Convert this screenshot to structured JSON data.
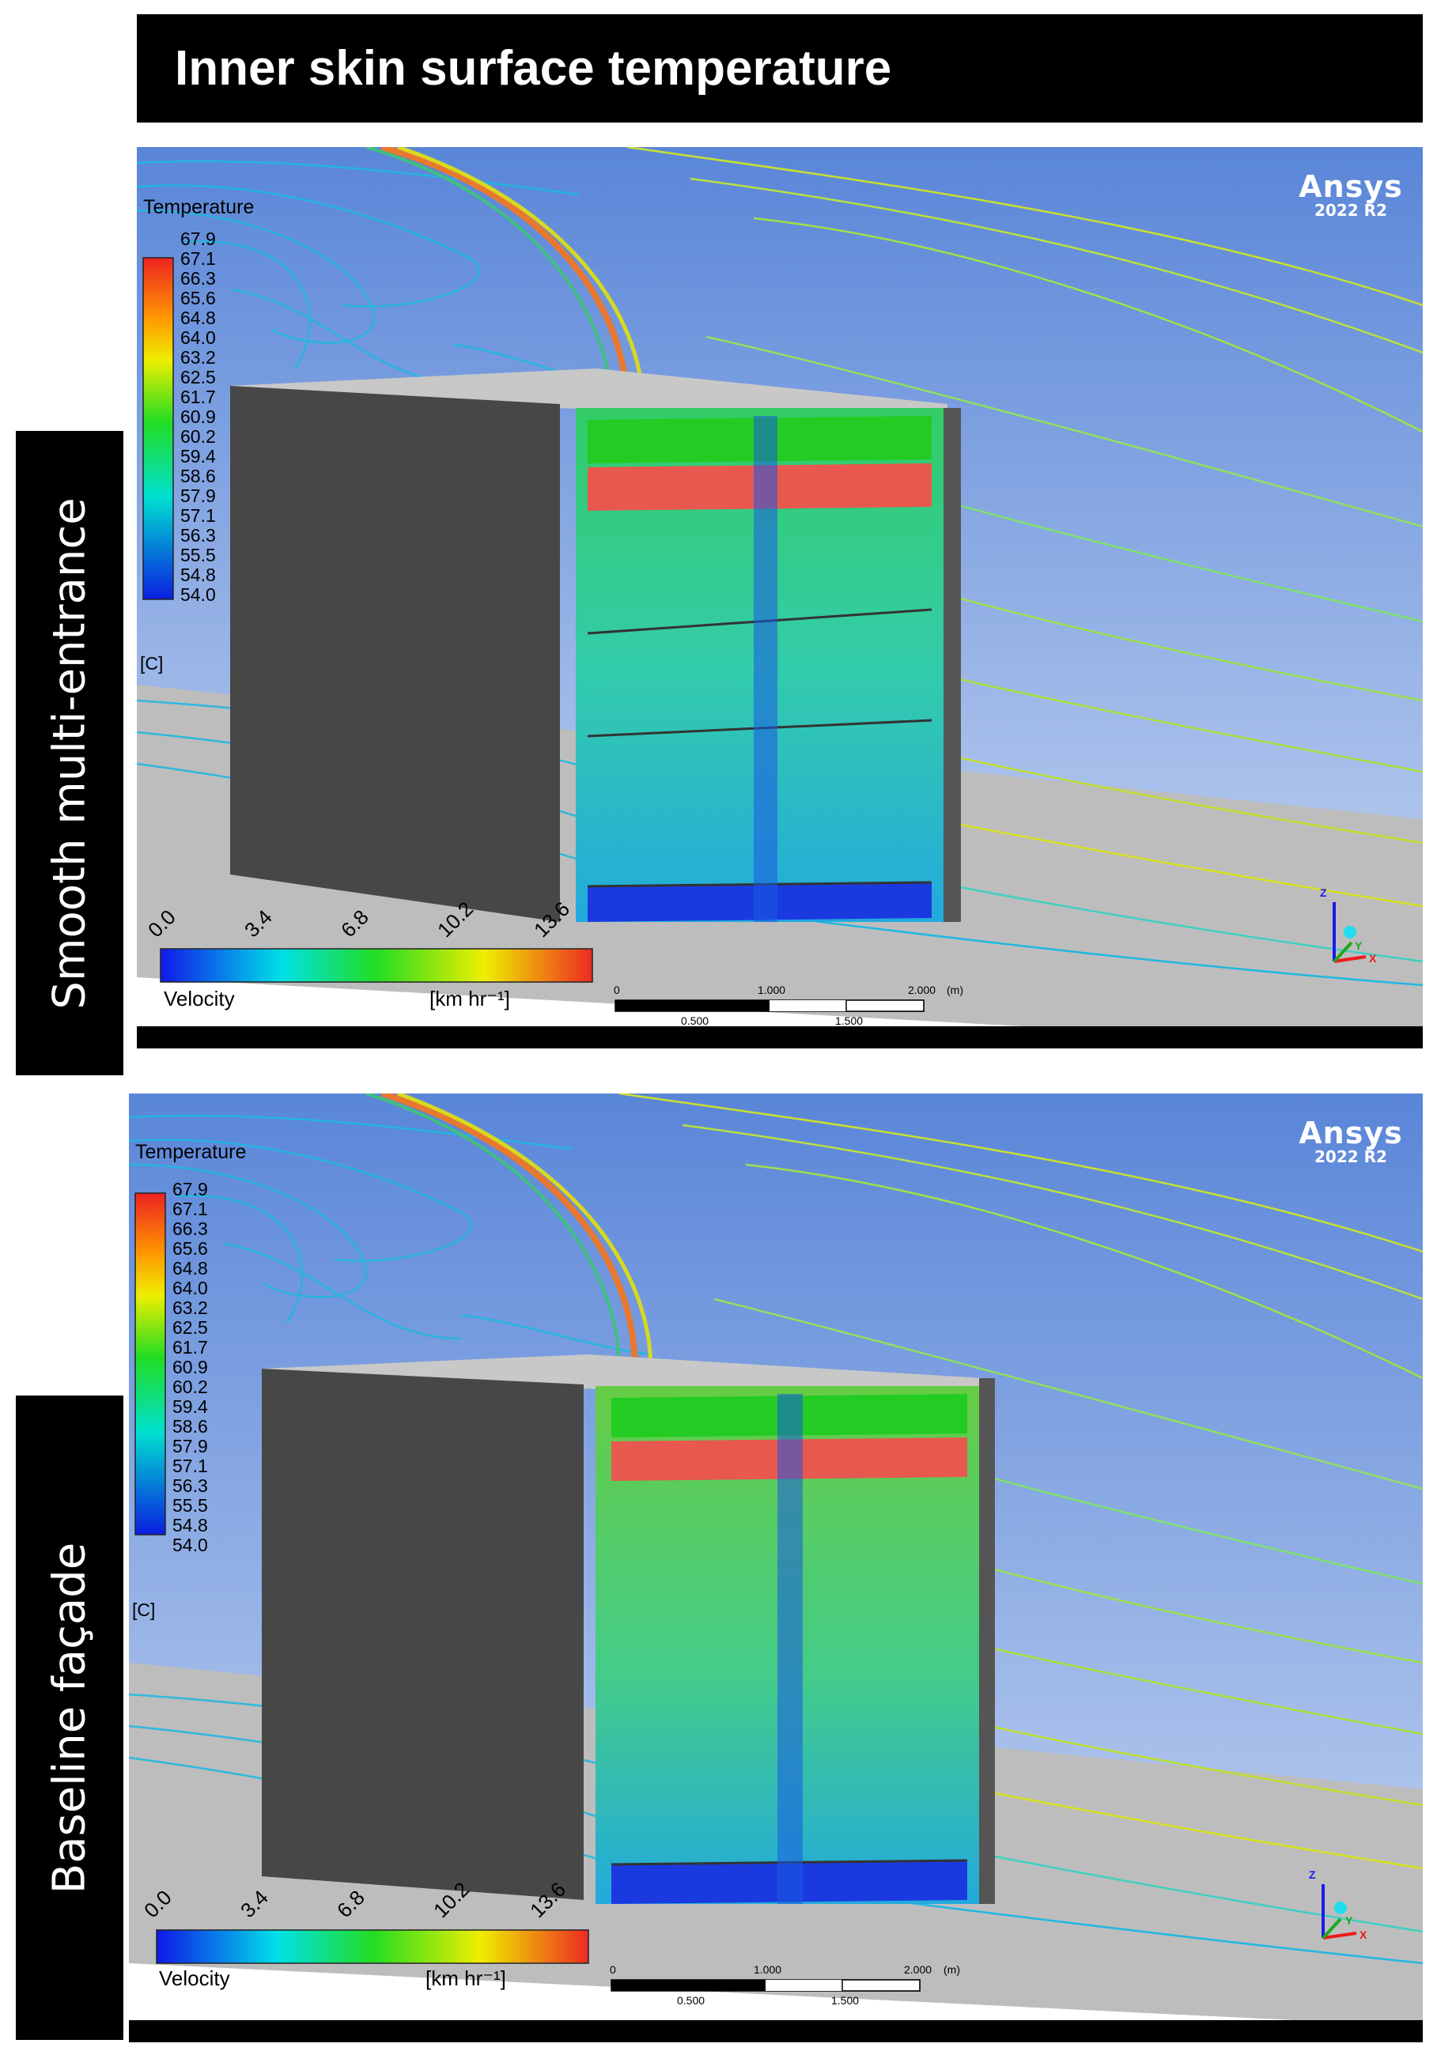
{
  "title": "Inner skin surface temperature",
  "panels": [
    {
      "side_label": "Smooth multi-entrance",
      "logo": "Ansys",
      "version": "2022 R2",
      "temp_legend": {
        "title": "Temperature",
        "unit": "[C]",
        "ticks": [
          "67.9",
          "67.1",
          "66.3",
          "65.6",
          "64.8",
          "64.0",
          "63.2",
          "62.5",
          "61.7",
          "60.9",
          "60.2",
          "59.4",
          "58.6",
          "57.9",
          "57.1",
          "56.3",
          "55.5",
          "54.8",
          "54.0"
        ]
      },
      "vel_legend": {
        "title": "Velocity",
        "unit": "[km hr⁻¹]",
        "ticks": [
          "0.0",
          "3.4",
          "6.8",
          "10.2",
          "13.6"
        ]
      },
      "scale_bar": {
        "top": [
          "0",
          "1.000",
          "2.000"
        ],
        "unit": "(m)",
        "bottom": [
          "0.500",
          "1.500"
        ]
      },
      "axes": {
        "z": "Z",
        "y": "Y",
        "x": "X"
      }
    },
    {
      "side_label": "Baseline façade",
      "logo": "Ansys",
      "version": "2022 R2",
      "temp_legend": {
        "title": "Temperature",
        "unit": "[C]",
        "ticks": [
          "67.9",
          "67.1",
          "66.3",
          "65.6",
          "64.8",
          "64.0",
          "63.2",
          "62.5",
          "61.7",
          "60.9",
          "60.2",
          "59.4",
          "58.6",
          "57.9",
          "57.1",
          "56.3",
          "55.5",
          "54.8",
          "54.0"
        ]
      },
      "vel_legend": {
        "title": "Velocity",
        "unit": "[km hr⁻¹]",
        "ticks": [
          "0.0",
          "3.4",
          "6.8",
          "10.2",
          "13.6"
        ]
      },
      "scale_bar": {
        "top": [
          "0",
          "1.000",
          "2.000"
        ],
        "unit": "(m)",
        "bottom": [
          "0.500",
          "1.500"
        ]
      },
      "axes": {
        "z": "Z",
        "y": "Y",
        "x": "X"
      }
    }
  ],
  "colors": {
    "sky_top": "#5a86d8",
    "sky_bottom": "#c9d8f2",
    "ground": "#bdbdbd",
    "box_dark": "#474747",
    "box_top": "#c8c8c8",
    "hot_band": "#e8584e",
    "green_band": "#22cc22"
  }
}
